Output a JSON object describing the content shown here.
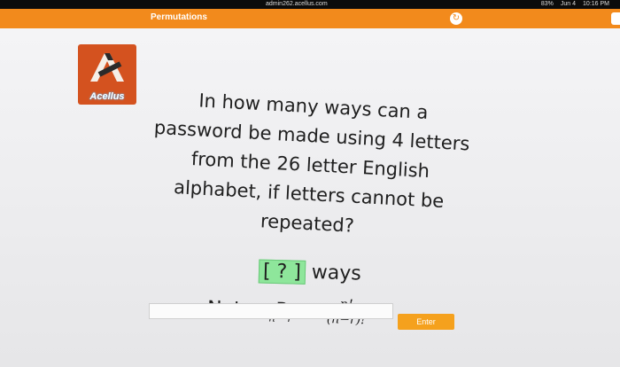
{
  "status_bar": {
    "url": "admin262.acellus.com",
    "battery": "83%",
    "date": "Jun 4",
    "time": "10:16 PM"
  },
  "title_bar": {
    "title": "Permutations",
    "accent_color": "#f28a1c"
  },
  "logo": {
    "text": "Acellus",
    "color": "#d4521f"
  },
  "question": {
    "lines": [
      "In how many ways can a",
      "password be made using 4 letters",
      "from the 26 letter English",
      "alphabet, if letters cannot be",
      "repeated?"
    ]
  },
  "answer": {
    "blank": "[ ? ]",
    "unit": "ways"
  },
  "note": {
    "label": "Note:",
    "pre_sub": "n",
    "symbol": "P",
    "post_sub": "r",
    "equals": "=",
    "numerator": "n!",
    "denominator": "(n−r)!"
  },
  "answer_input": {
    "value": ""
  },
  "enter_button": {
    "label": "Enter",
    "color": "#f5a11d"
  }
}
